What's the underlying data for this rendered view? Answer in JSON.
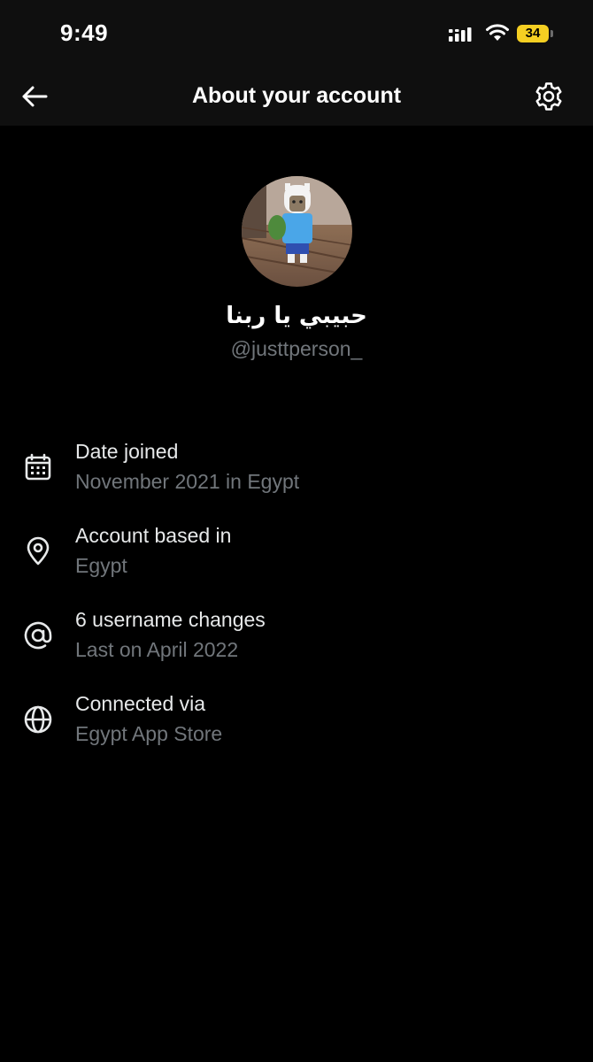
{
  "status_bar": {
    "time": "9:49",
    "battery_level": "34",
    "battery_color": "#f5cf22"
  },
  "header": {
    "title": "About your account",
    "back_icon": "arrow-left-icon",
    "settings_icon": "gear-icon"
  },
  "profile": {
    "display_name": "حبيبي يا ربنا",
    "username": "@justtperson_",
    "avatar_icon": "profile-avatar"
  },
  "info_items": [
    {
      "icon": "calendar-icon",
      "label": "Date joined",
      "value": "November 2021 in Egypt"
    },
    {
      "icon": "location-pin-icon",
      "label": "Account based in",
      "value": "Egypt"
    },
    {
      "icon": "at-sign-icon",
      "label": "6 username changes",
      "value": "Last on April 2022"
    },
    {
      "icon": "globe-icon",
      "label": "Connected via",
      "value": "Egypt App Store"
    }
  ],
  "colors": {
    "background": "#000000",
    "header_background": "#0f0f0f",
    "primary_text": "#e7e9ea",
    "secondary_text": "#71767b"
  }
}
